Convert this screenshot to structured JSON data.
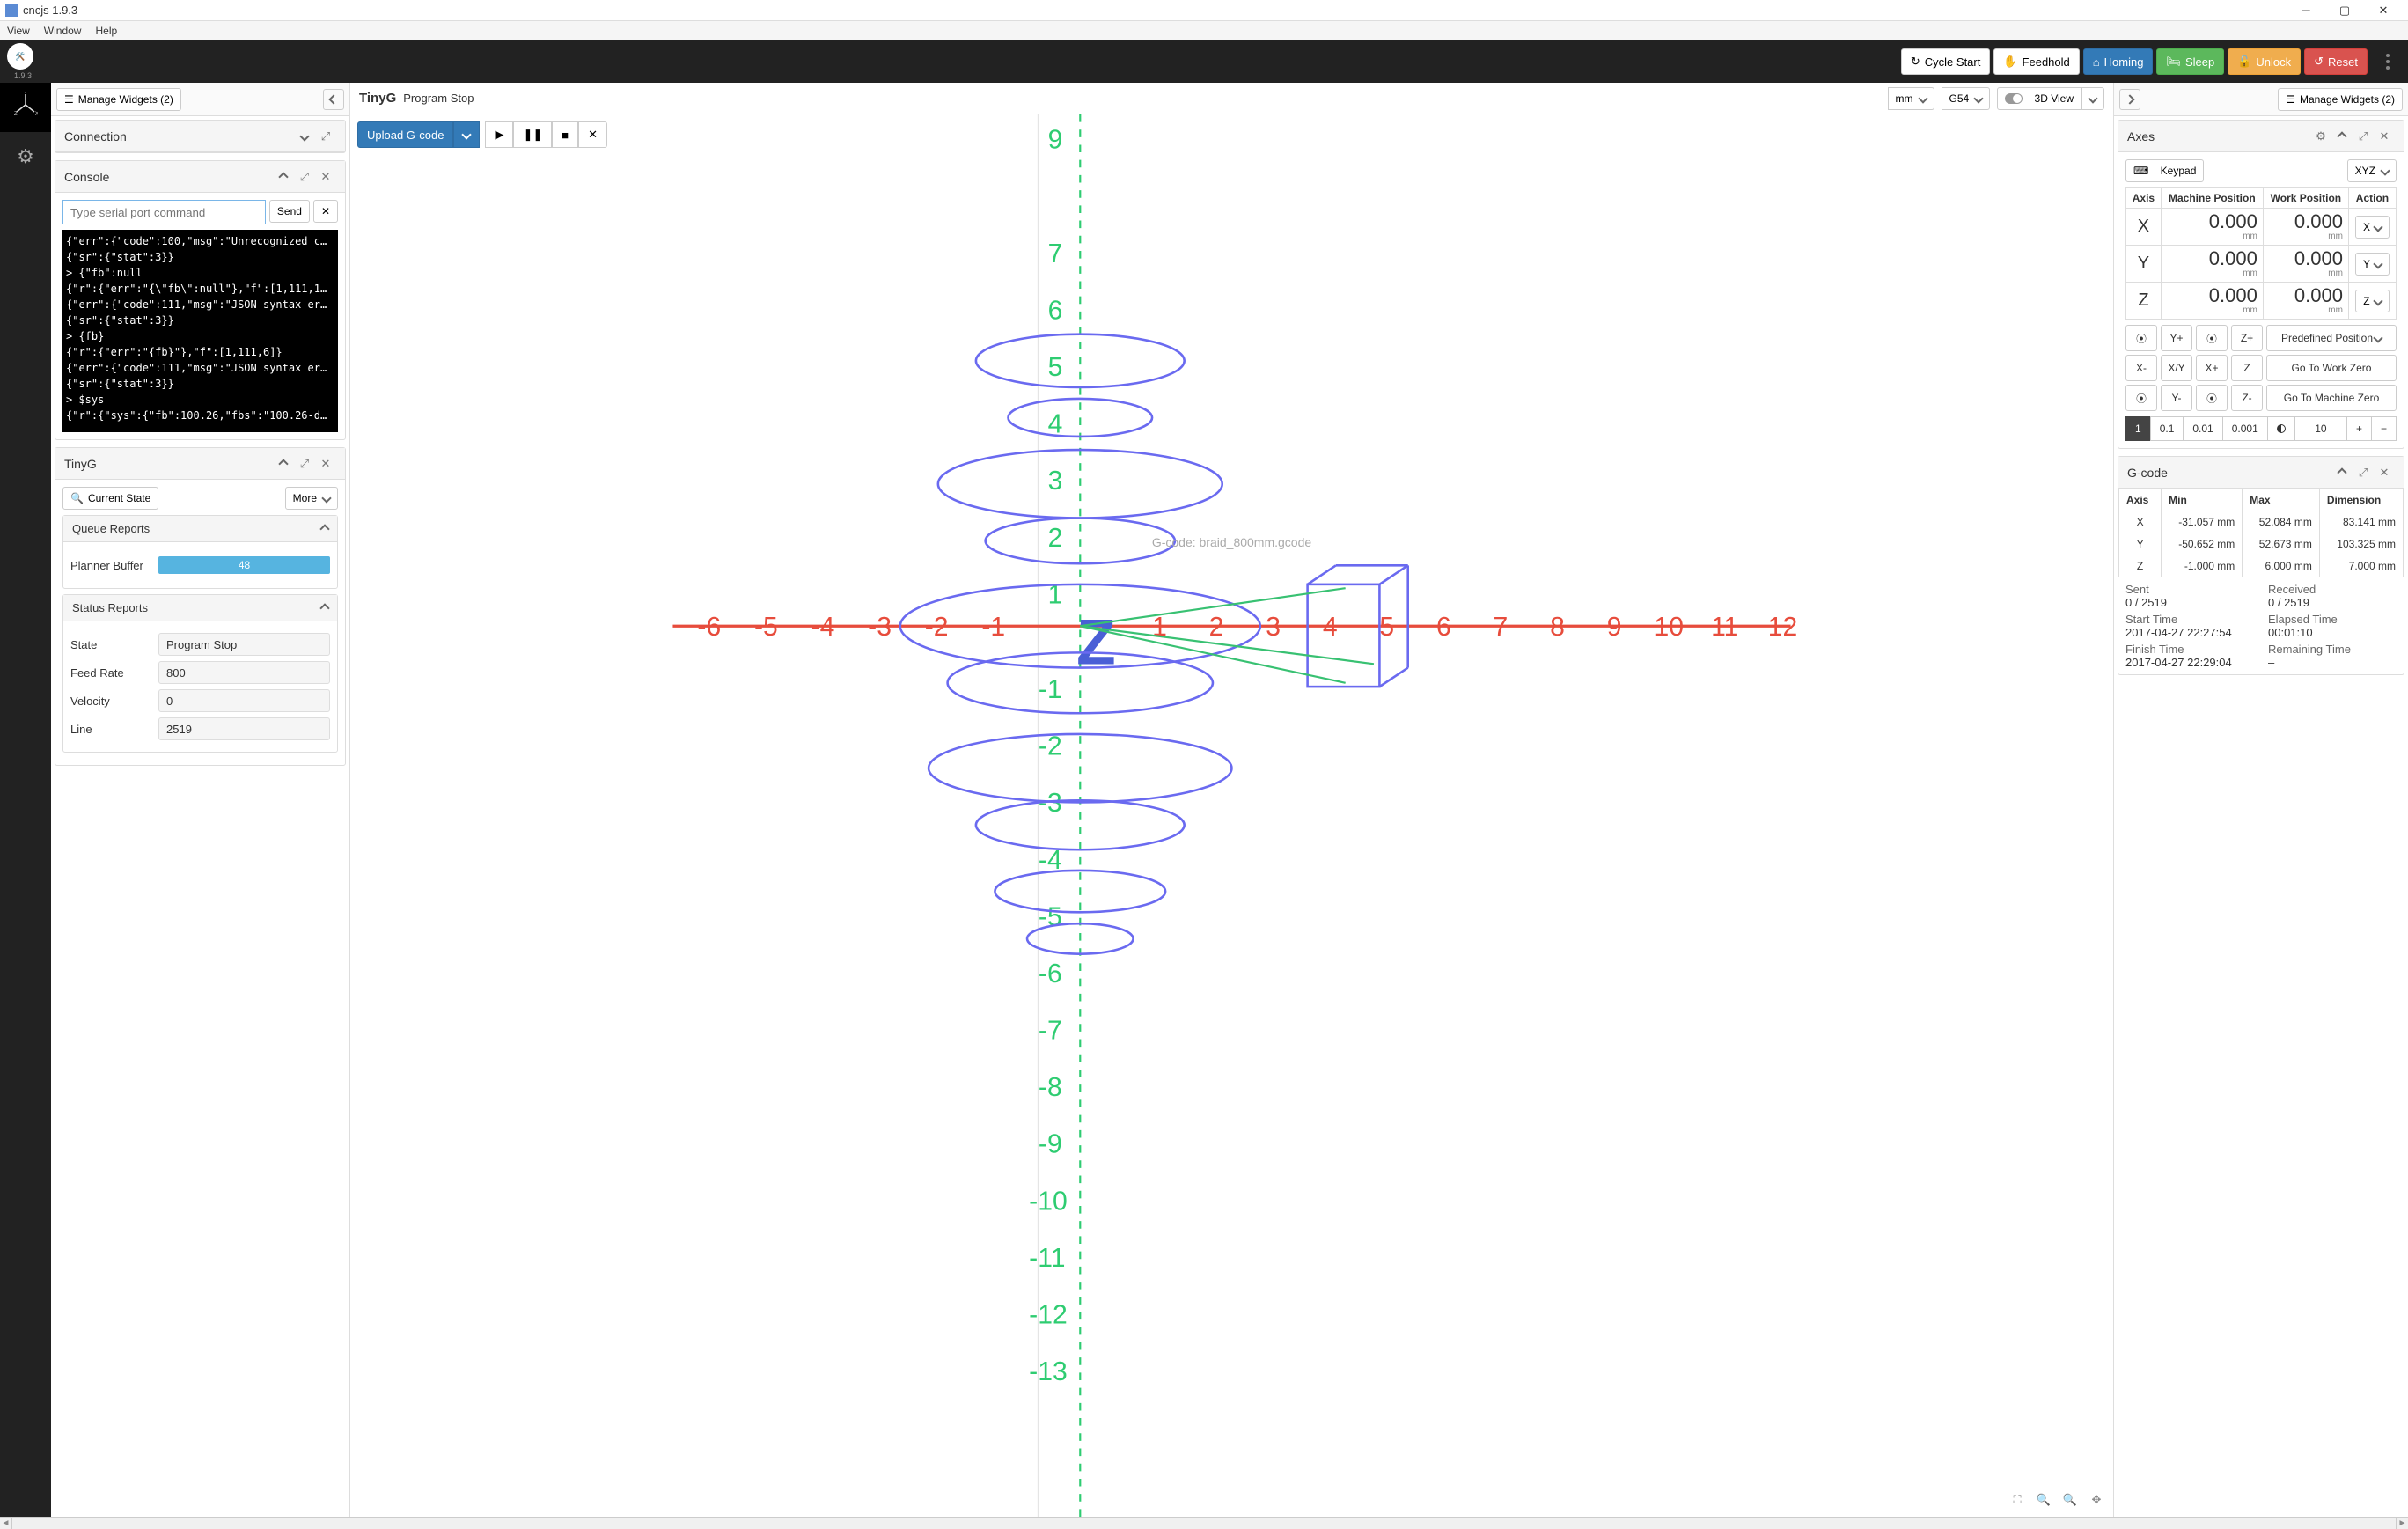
{
  "window": {
    "title": "cncjs 1.9.3",
    "version": "1.9.3"
  },
  "menu": {
    "view": "View",
    "window": "Window",
    "help": "Help"
  },
  "topbar": {
    "cycle_start": "Cycle Start",
    "feedhold": "Feedhold",
    "homing": "Homing",
    "sleep": "Sleep",
    "unlock": "Unlock",
    "reset": "Reset"
  },
  "left_toolbar": {
    "manage": "Manage Widgets (2)"
  },
  "right_toolbar": {
    "manage": "Manage Widgets (2)"
  },
  "connection": {
    "title": "Connection"
  },
  "console": {
    "title": "Console",
    "placeholder": "Type serial port command",
    "send": "Send",
    "lines": [
      "{\"err\":{\"code\":100,\"msg\":\"Unrecognized c…",
      "{\"sr\":{\"stat\":3}}",
      "> {\"fb\":null",
      "{\"r\":{\"err\":\"{\\\"fb\\\":null\"},\"f\":[1,111,1…",
      "{\"err\":{\"code\":111,\"msg\":\"JSON syntax er…",
      "{\"sr\":{\"stat\":3}}",
      "> {fb}",
      "{\"r\":{\"err\":\"{fb}\"},\"f\":[1,111,6]}",
      "{\"err\":{\"code\":111,\"msg\":\"JSON syntax er…",
      "{\"sr\":{\"stat\":3}}",
      "> $sys",
      "{\"r\":{\"sys\":{\"fb\":100.26,\"fbs\":\"100.26-d…"
    ]
  },
  "tinyg": {
    "title": "TinyG",
    "current_state": "Current State",
    "more": "More",
    "queue_reports": "Queue Reports",
    "planner_buffer": "Planner Buffer",
    "planner_buffer_val": "48",
    "status_reports": "Status Reports",
    "state": "State",
    "state_val": "Program Stop",
    "feed_rate": "Feed Rate",
    "feed_rate_val": "800",
    "velocity": "Velocity",
    "velocity_val": "0",
    "line": "Line",
    "line_val": "2519"
  },
  "center": {
    "controller": "TinyG",
    "status": "Program Stop",
    "unit": "mm",
    "wcs": "G54",
    "view": "3D View",
    "upload": "Upload G-code",
    "caption": "G-code: braid_800mm.gcode"
  },
  "axes": {
    "title": "Axes",
    "keypad": "Keypad",
    "xyz": "XYZ",
    "hdr": {
      "axis": "Axis",
      "mpos": "Machine Position",
      "wpos": "Work Position",
      "action": "Action"
    },
    "rows": [
      {
        "axis": "X",
        "m": "0.000",
        "w": "0.000",
        "act": "X"
      },
      {
        "axis": "Y",
        "m": "0.000",
        "w": "0.000",
        "act": "Y"
      },
      {
        "axis": "Z",
        "m": "0.000",
        "w": "0.000",
        "act": "Z"
      }
    ],
    "unit": "mm",
    "predefined": "Predefined Position",
    "goto_work": "Go To Work Zero",
    "goto_machine": "Go To Machine Zero",
    "jog": {
      "yp": "Y+",
      "zp": "Z+",
      "xm": "X-",
      "xy": "X/Y",
      "xp": "X+",
      "z": "Z",
      "ym": "Y-",
      "zm": "Z-"
    },
    "steps": [
      "1",
      "0.1",
      "0.01",
      "0.001"
    ],
    "custom_step": "10"
  },
  "gcode": {
    "title": "G-code",
    "hdr": {
      "axis": "Axis",
      "min": "Min",
      "max": "Max",
      "dim": "Dimension"
    },
    "rows": [
      {
        "axis": "X",
        "min": "-31.057 mm",
        "max": "52.084 mm",
        "dim": "83.141 mm"
      },
      {
        "axis": "Y",
        "min": "-50.652 mm",
        "max": "52.673 mm",
        "dim": "103.325 mm"
      },
      {
        "axis": "Z",
        "min": "-1.000 mm",
        "max": "6.000 mm",
        "dim": "7.000 mm"
      }
    ],
    "sent": "Sent",
    "sent_val": "0 / 2519",
    "received": "Received",
    "received_val": "0 / 2519",
    "start": "Start Time",
    "start_val": "2017-04-27 22:27:54",
    "elapsed": "Elapsed Time",
    "elapsed_val": "00:01:10",
    "finish": "Finish Time",
    "finish_val": "2017-04-27 22:29:04",
    "remaining": "Remaining Time",
    "remaining_val": "–"
  }
}
